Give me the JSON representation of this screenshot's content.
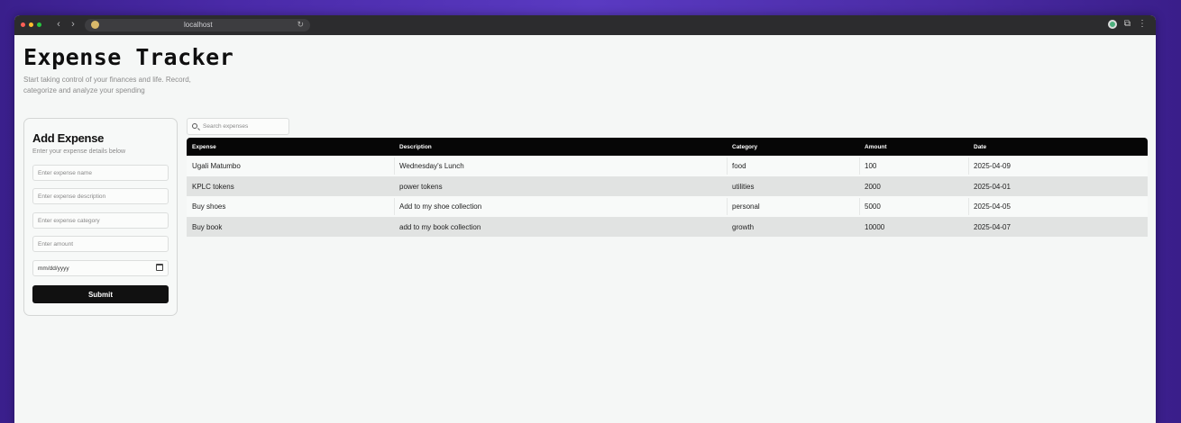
{
  "browser": {
    "url": "localhost",
    "colors": {
      "close": "#ff5f57",
      "minimize": "#febc2e",
      "maximize": "#28c840"
    }
  },
  "page": {
    "title": "Expense Tracker",
    "subtitle": "Start taking control of your finances and life. Record, categorize and analyze your spending"
  },
  "form": {
    "title": "Add Expense",
    "subtitle": "Enter your expense details below",
    "name_placeholder": "Enter expense name",
    "description_placeholder": "Enter expense description",
    "category_placeholder": "Enter expense category",
    "amount_placeholder": "Enter amount",
    "date_placeholder": "mm/dd/yyyy",
    "submit_label": "Submit"
  },
  "search": {
    "placeholder": "Search expenses"
  },
  "table": {
    "headers": [
      "Expense",
      "Description",
      "Category",
      "Amount",
      "Date"
    ],
    "rows": [
      [
        "Ugali Matumbo",
        "Wednesday's Lunch",
        "food",
        "100",
        "2025-04-09"
      ],
      [
        "KPLC tokens",
        "power tokens",
        "utilities",
        "2000",
        "2025-04-01"
      ],
      [
        "Buy shoes",
        "Add to my shoe collection",
        "personal",
        "5000",
        "2025-04-05"
      ],
      [
        "Buy book",
        "add to my book collection",
        "growth",
        "10000",
        "2025-04-07"
      ]
    ]
  }
}
